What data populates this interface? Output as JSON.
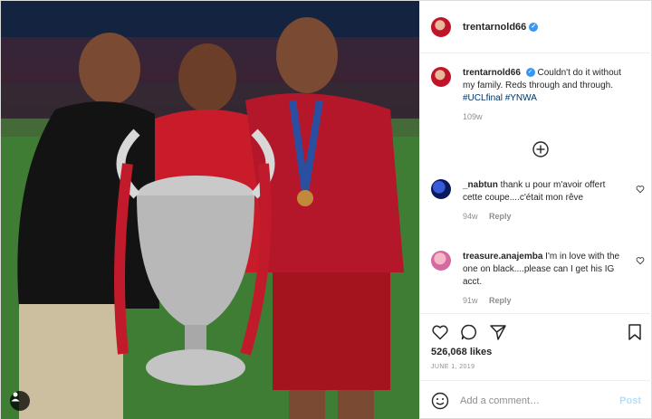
{
  "post": {
    "username": "trentarnold66",
    "caption_username": "trentarnold66",
    "caption_text": "Couldn't do it without my family. Reds through and through.",
    "caption_tags": "#UCLfinal #YNWA",
    "caption_time": "109w"
  },
  "comments": [
    {
      "username": "_nabtun",
      "text": "thank u pour m'avoir offert cette coupe....c'était mon rêve",
      "time": "94w",
      "reply_label": "Reply"
    },
    {
      "username": "treasure.anajemba",
      "text": "I'm in love with the one on black....please can I get his IG acct.",
      "time": "91w",
      "reply_label": "Reply"
    }
  ],
  "stats": {
    "likes": "526,068 likes",
    "date": "JUNE 1, 2019"
  },
  "composer": {
    "placeholder": "Add a comment…",
    "post_label": "Post"
  },
  "colors": {
    "verified": "#3897f0",
    "tag_link": "#003569",
    "post_disabled": "#b2dffc"
  },
  "icons": {
    "heart": "heart-icon",
    "comment": "comment-icon",
    "share": "share-icon",
    "bookmark": "bookmark-icon",
    "emoji": "emoji-icon",
    "add": "add-circle-icon",
    "tag": "person-tag-icon"
  }
}
